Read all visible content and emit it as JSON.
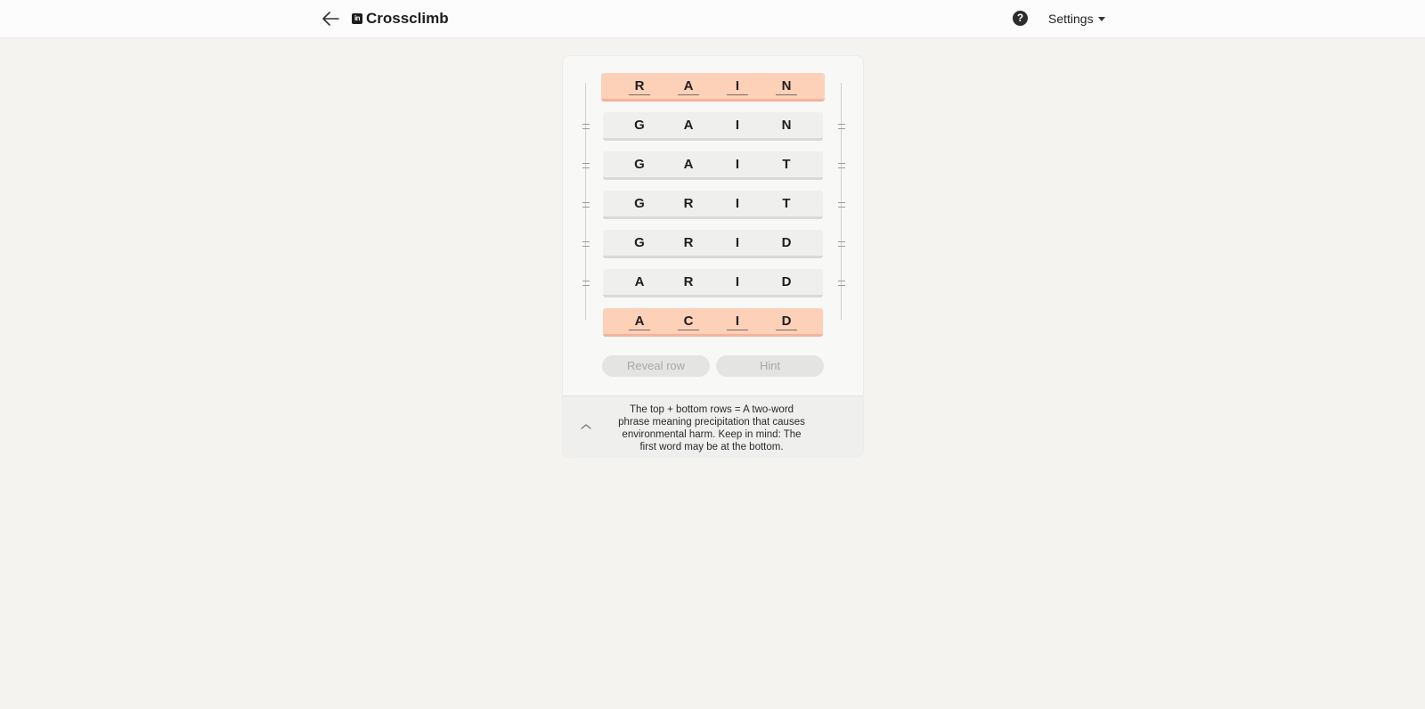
{
  "header": {
    "back_icon": "arrow-left-icon",
    "logo_text": "in",
    "title": "Crossclimb",
    "help_symbol": "?",
    "settings_label": "Settings"
  },
  "colors": {
    "highlight_row": "#fdd0b8",
    "plain_row": "#efefee",
    "page_bg": "#f4f3f0"
  },
  "game": {
    "rows": [
      {
        "letters": [
          "R",
          "A",
          "I",
          "N"
        ],
        "highlight": true
      },
      {
        "letters": [
          "G",
          "A",
          "I",
          "N"
        ],
        "highlight": false
      },
      {
        "letters": [
          "G",
          "A",
          "I",
          "T"
        ],
        "highlight": false
      },
      {
        "letters": [
          "G",
          "R",
          "I",
          "T"
        ],
        "highlight": false
      },
      {
        "letters": [
          "G",
          "R",
          "I",
          "D"
        ],
        "highlight": false
      },
      {
        "letters": [
          "A",
          "R",
          "I",
          "D"
        ],
        "highlight": false
      },
      {
        "letters": [
          "A",
          "C",
          "I",
          "D"
        ],
        "highlight": true
      }
    ],
    "reveal_row_label": "Reveal row",
    "hint_label": "Hint"
  },
  "clue": {
    "line1": "The top + bottom rows = A two-word",
    "line2": "phrase meaning precipitation that causes",
    "line3": "environmental harm. Keep in mind: The",
    "line4": "first word may be at the bottom."
  }
}
